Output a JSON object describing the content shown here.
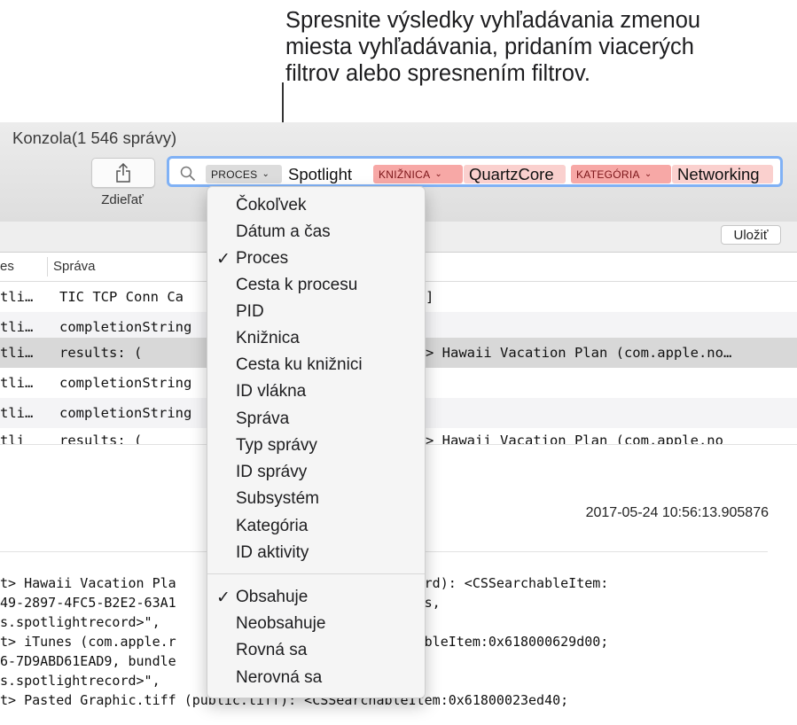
{
  "callout": {
    "lines": [
      "Spresnite výsledky vyhľadávania zmenou",
      "miesta vyhľadávania, pridaním viacerých",
      "filtrov alebo spresnením filtrov."
    ]
  },
  "window": {
    "title": "Konzola(1 546 správy)",
    "share_label": "Zdieľať",
    "save_label": "Uložiť"
  },
  "search": {
    "tokens": [
      {
        "selector": "PROCES",
        "value": "Spotlight"
      },
      {
        "selector": "KNIŽNICA",
        "value": "QuartzCore"
      },
      {
        "selector": "KATEGÓRIA",
        "value": "Networking"
      }
    ]
  },
  "table": {
    "headers": [
      "es",
      "Správa"
    ],
    "rows": [
      {
        "c1": "tli…",
        "c2": "TIC TCP Conn Ca",
        "c3": "]"
      },
      {
        "c1": "tli…",
        "c2": "completionString",
        "c3": ""
      },
      {
        "c1": "tli…",
        "c2": "results: (",
        "c3": "> Hawaii Vacation Plan (com.apple.no…"
      },
      {
        "c1": "tli…",
        "c2": "completionString",
        "c3": ""
      },
      {
        "c1": "tli…",
        "c2": "completionString",
        "c3": ""
      },
      {
        "c1": "tli",
        "c2": "results: (",
        "c3": "> Hawaii Vacation Plan (com.apple.no"
      }
    ]
  },
  "detail": {
    "timestamp": "2017-05-24 10:56:13.905876",
    "log_lines": [
      "t> Hawaii Vacation Pla                     tlightrecord): <CSSearchableItem:",
      "49-2897-4FC5-B2E2-63A1                    .apple.Notes,",
      "s.spotlightrecord>\",",
      "t> iTunes (com.apple.r                     <CSSearchableItem:0x618000629d00;",
      "6-7D9ABD61EAD9, bundle",
      "s.spotlightrecord>\",",
      "t> Pasted Graphic.tiff (public.tiff): <CSSearchableItem:0x61800023ed40;"
    ]
  },
  "menu": {
    "items": [
      {
        "label": "Čokoľvek",
        "checked": ""
      },
      {
        "label": "Dátum a čas",
        "checked": ""
      },
      {
        "label": "Proces",
        "checked": "✓"
      },
      {
        "label": "Cesta k procesu",
        "checked": ""
      },
      {
        "label": "PID",
        "checked": ""
      },
      {
        "label": "Knižnica",
        "checked": ""
      },
      {
        "label": "Cesta ku knižnici",
        "checked": ""
      },
      {
        "label": "ID vlákna",
        "checked": ""
      },
      {
        "label": "Správa",
        "checked": ""
      },
      {
        "label": "Typ správy",
        "checked": ""
      },
      {
        "label": "ID správy",
        "checked": ""
      },
      {
        "label": "Subsystém",
        "checked": ""
      },
      {
        "label": "Kategória",
        "checked": ""
      },
      {
        "label": "ID aktivity",
        "checked": ""
      }
    ],
    "match_items": [
      {
        "label": "Obsahuje",
        "checked": "✓"
      },
      {
        "label": "Neobsahuje",
        "checked": ""
      },
      {
        "label": "Rovná sa",
        "checked": ""
      },
      {
        "label": "Nerovná sa",
        "checked": ""
      }
    ]
  },
  "colors": {
    "search_focus": "#80b1f5",
    "token_red_selector": "#f7a8a6",
    "token_red_value": "#fad0ce",
    "token_gray_selector": "#dcdcdc"
  }
}
